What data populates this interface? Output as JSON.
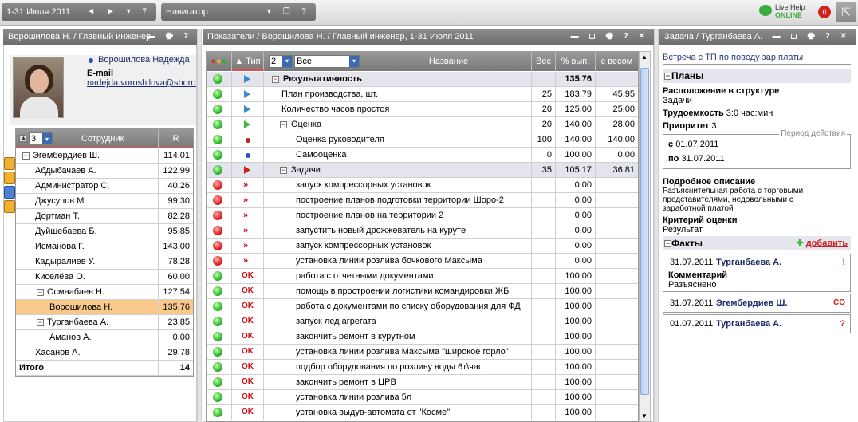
{
  "topbar": {
    "period": "1-31 Июля 2011",
    "navigator": "Навигатор",
    "live_help": "Live Help",
    "online": "ONLINE",
    "badge": "0"
  },
  "left": {
    "header": "Ворошилова Н. / Главный инженер",
    "name": "Ворошилова Надежда",
    "email_label": "E-mail",
    "email": "nadejda.voroshilova@shoro.kg",
    "level": "3",
    "col_employee": "Сотрудник",
    "col_r": "R",
    "rows": [
      {
        "name": "Эгембердиев Ш.",
        "value": "114.01"
      },
      {
        "name": "Абдыбачаев А.",
        "value": "122.99"
      },
      {
        "name": "Администратор С.",
        "value": "40.26"
      },
      {
        "name": "Джусупов М.",
        "value": "99.30"
      },
      {
        "name": "Дортман Т.",
        "value": "82.28"
      },
      {
        "name": "Дуйшебаева Б.",
        "value": "95.85"
      },
      {
        "name": "Исманова Г.",
        "value": "143.00"
      },
      {
        "name": "Кадыралиев У.",
        "value": "78.28"
      },
      {
        "name": "Киселёва О.",
        "value": "60.00"
      },
      {
        "name": "Осмнабаев Н.",
        "value": "127.54"
      },
      {
        "name": "Ворошилова Н.",
        "value": "135.76"
      },
      {
        "name": "Турганбаева А.",
        "value": "23.85"
      },
      {
        "name": "Аманов А.",
        "value": "0.00"
      },
      {
        "name": "Хасанов А.",
        "value": "29.78"
      }
    ],
    "total_label": "Итого",
    "total_value": "14"
  },
  "middle": {
    "header": "Показатели / Ворошилова Н. / Главный инженер, 1-31 Июля 2011",
    "col_type": "Тип",
    "level": "2",
    "filter": "Все",
    "col_name": "Название",
    "col_weight": "Вес",
    "col_pct": "% вып.",
    "col_weighted": "с весом",
    "rows": [
      {
        "name": "Результативность",
        "weight": "",
        "pct": "135.76",
        "w": ""
      },
      {
        "name": "План производства, шт.",
        "weight": "25",
        "pct": "183.79",
        "w": "45.95"
      },
      {
        "name": "Количество часов простоя",
        "weight": "20",
        "pct": "125.00",
        "w": "25.00"
      },
      {
        "name": "Оценка",
        "weight": "20",
        "pct": "140.00",
        "w": "28.00"
      },
      {
        "name": "Оценка руководителя",
        "weight": "100",
        "pct": "140.00",
        "w": "140.00"
      },
      {
        "name": "Самооценка",
        "weight": "0",
        "pct": "100.00",
        "w": "0.00"
      },
      {
        "name": "Задачи",
        "weight": "35",
        "pct": "105.17",
        "w": "36.81"
      },
      {
        "name": "запуск компрессорных установок",
        "weight": "",
        "pct": "0.00",
        "w": ""
      },
      {
        "name": "построение планов подготовки территории Шоро-2",
        "weight": "",
        "pct": "0.00",
        "w": ""
      },
      {
        "name": "построение планов на территории 2",
        "weight": "",
        "pct": "0.00",
        "w": ""
      },
      {
        "name": "запустить новый дрожжеватель на куруте",
        "weight": "",
        "pct": "0.00",
        "w": ""
      },
      {
        "name": "запуск компрессорных установок",
        "weight": "",
        "pct": "0.00",
        "w": ""
      },
      {
        "name": "установка линии розлива бочкового Максыма",
        "weight": "",
        "pct": "0.00",
        "w": ""
      },
      {
        "name": "работа с отчетными документами",
        "weight": "",
        "pct": "100.00",
        "w": ""
      },
      {
        "name": "помощь в простроении логистики командировки ЖБ",
        "weight": "",
        "pct": "100.00",
        "w": ""
      },
      {
        "name": "работа с документами по списку оборудования для ФД",
        "weight": "",
        "pct": "100.00",
        "w": ""
      },
      {
        "name": "запуск лед агрегата",
        "weight": "",
        "pct": "100.00",
        "w": ""
      },
      {
        "name": "закончить ремонт в курутном",
        "weight": "",
        "pct": "100.00",
        "w": ""
      },
      {
        "name": "установка линии розлива Максыма \"широкое горло\"",
        "weight": "",
        "pct": "100.00",
        "w": ""
      },
      {
        "name": "подбор оборудования по розливу воды 6т\\час",
        "weight": "",
        "pct": "100.00",
        "w": ""
      },
      {
        "name": "закончить ремонт в ЦРВ",
        "weight": "",
        "pct": "100.00",
        "w": ""
      },
      {
        "name": "установка линии розлива 5л",
        "weight": "",
        "pct": "100.00",
        "w": ""
      },
      {
        "name": "установка выдув-автомата от \"Космe\"",
        "weight": "",
        "pct": "100.00",
        "w": ""
      }
    ],
    "ok_label": "OK",
    "rr_label": "»"
  },
  "right": {
    "header": "Задача / Турганбаева А.",
    "title": "Встреча с ТП по поводу зар.платы",
    "plans": "Планы",
    "location_label": "Расположение в структуре",
    "location_value": "Задачи",
    "effort_label": "Трудоемкость",
    "effort_value": "3:0",
    "effort_unit": "час:мин",
    "priority_label": "Приоритет",
    "priority_value": "3",
    "period_label": "Период действия",
    "from_label": "с",
    "from_value": "01.07.2011",
    "to_label": "по",
    "to_value": "31.07.2011",
    "desc_label": "Подробное описание",
    "desc_value": "Разъяснительная работа с торговыми представителями, недовольными с заработной платой",
    "crit_label": "Критерий оценки",
    "crit_value": "Результат",
    "facts": "Факты",
    "add": "добавить",
    "fact_items": [
      {
        "date": "31.07.2011",
        "who": "Турганбаева А.",
        "mark": "!",
        "comment_label": "Комментарий",
        "comment": "Разъяснено"
      },
      {
        "date": "31.07.2011",
        "who": "Эгембердиев Ш.",
        "mark": "CO"
      },
      {
        "date": "01.07.2011",
        "who": "Турганбаева А.",
        "mark": "?"
      }
    ]
  }
}
